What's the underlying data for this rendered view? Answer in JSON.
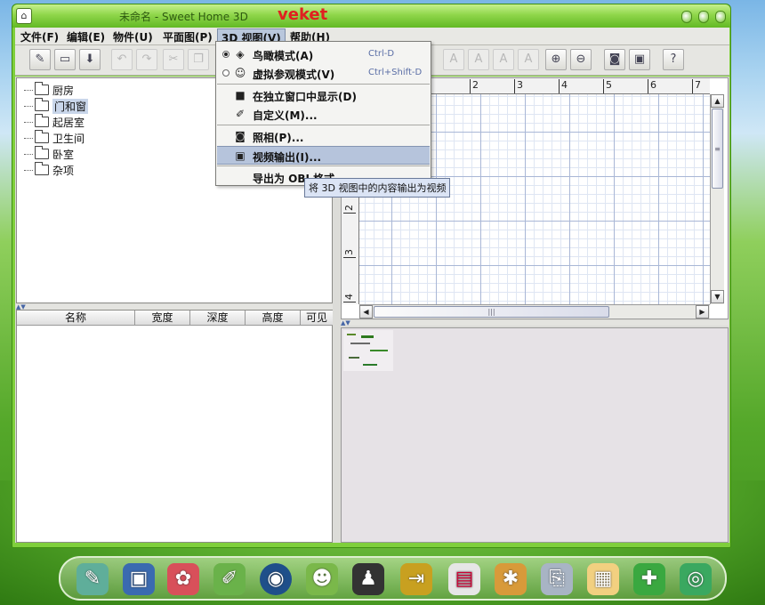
{
  "window": {
    "title": "未命名 - Sweet Home 3D",
    "brand": "veket"
  },
  "menubar": [
    {
      "label": "文件(F)"
    },
    {
      "label": "编辑(E)"
    },
    {
      "label": "物件(U)"
    },
    {
      "label": "平面图(P)"
    },
    {
      "label": "3D 视图(V)"
    },
    {
      "label": "帮助(H)"
    }
  ],
  "catalog": [
    {
      "label": "厨房"
    },
    {
      "label": "门和窗"
    },
    {
      "label": "起居室"
    },
    {
      "label": "卫生间"
    },
    {
      "label": "卧室"
    },
    {
      "label": "杂项"
    }
  ],
  "furniture_table": {
    "columns": [
      "名称",
      "宽度",
      "深度",
      "高度",
      "可见"
    ]
  },
  "plan": {
    "ruler_top": [
      "2",
      "3",
      "4",
      "5",
      "6",
      "7"
    ],
    "ruler_left": [
      "2",
      "3",
      "4"
    ]
  },
  "view3d_menu": {
    "aerial": {
      "label": "鸟瞰模式(A)",
      "shortcut": "Ctrl-D"
    },
    "virtual": {
      "label": "虚拟参观模式(V)",
      "shortcut": "Ctrl+Shift-D"
    },
    "separate": {
      "label": "在独立窗口中显示(D)"
    },
    "customize": {
      "label": "自定义(M)..."
    },
    "photo": {
      "label": "照相(P)..."
    },
    "video": {
      "label": "视频输出(I)..."
    },
    "export": {
      "label": "导出为 OBJ 格式..."
    }
  },
  "tooltip": "将 3D 视图中的内容输出为视频",
  "icons": {
    "new": "new-file-icon",
    "open": "open-folder-icon",
    "save": "save-icon",
    "undo": "undo-icon",
    "redo": "redo-icon",
    "cut": "cut-icon",
    "copy": "copy-icon",
    "zoom_in": "zoom-in-icon",
    "zoom_out": "zoom-out-icon",
    "camera": "camera-icon",
    "help": "help-icon"
  }
}
